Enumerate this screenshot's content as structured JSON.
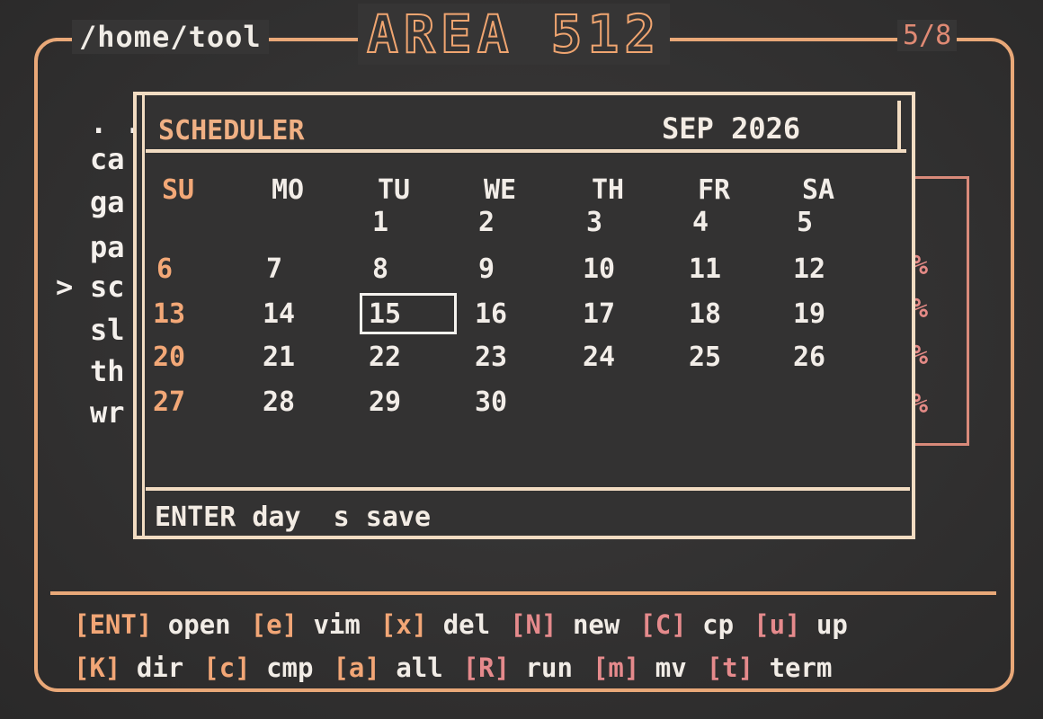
{
  "header": {
    "path": "/home/tool",
    "brand": "AREA 512",
    "pager": "5/8"
  },
  "file_list": {
    "items": [
      {
        "label": ". .",
        "selected": false
      },
      {
        "label": "ca",
        "selected": false
      },
      {
        "label": "ga",
        "selected": false
      },
      {
        "label": "pa",
        "selected": false
      },
      {
        "label": "sc",
        "selected": true
      },
      {
        "label": "sl",
        "selected": false
      },
      {
        "label": "th",
        "selected": false
      },
      {
        "label": "wr",
        "selected": false
      }
    ],
    "cursor": ">"
  },
  "side_panel": {
    "percents": [
      "%",
      "%",
      "%",
      "%"
    ]
  },
  "scheduler": {
    "title": "SCHEDULER",
    "month": "SEP 2026",
    "weekdays": [
      "SU",
      "MO",
      "TU",
      "WE",
      "TH",
      "FR",
      "SA"
    ],
    "weeks": [
      [
        "",
        "",
        "1",
        "2",
        "3",
        "4",
        "5"
      ],
      [
        "6",
        "7",
        "8",
        "9",
        "10",
        "11",
        "12"
      ],
      [
        "13",
        "14",
        "15",
        "16",
        "17",
        "18",
        "19"
      ],
      [
        "20",
        "21",
        "22",
        "23",
        "24",
        "25",
        "26"
      ],
      [
        "27",
        "28",
        "29",
        "30",
        "",
        "",
        ""
      ]
    ],
    "selected_day": "15",
    "footer": "ENTER day  s save"
  },
  "keybar": {
    "rows": [
      [
        {
          "key": "[ENT]",
          "desc": "open",
          "color": "orange"
        },
        {
          "key": "[e]",
          "desc": "vim",
          "color": "orange"
        },
        {
          "key": "[x]",
          "desc": "del",
          "color": "orange"
        },
        {
          "key": "[N]",
          "desc": "new",
          "color": "pink"
        },
        {
          "key": "[C]",
          "desc": "cp",
          "color": "pink"
        },
        {
          "key": "[u]",
          "desc": "up",
          "color": "pink"
        }
      ],
      [
        {
          "key": "[K]",
          "desc": "dir",
          "color": "orange"
        },
        {
          "key": "[c]",
          "desc": "cmp",
          "color": "orange"
        },
        {
          "key": "[a]",
          "desc": "all",
          "color": "orange"
        },
        {
          "key": "[R]",
          "desc": "run",
          "color": "pink"
        },
        {
          "key": "[m]",
          "desc": "mv",
          "color": "pink"
        },
        {
          "key": "[t]",
          "desc": "term",
          "color": "pink"
        }
      ]
    ]
  },
  "colors": {
    "frame": "#e9a878",
    "accent": "#f3a877",
    "pink": "#e58a8c",
    "text": "#f2ede8",
    "background": "#333232"
  }
}
